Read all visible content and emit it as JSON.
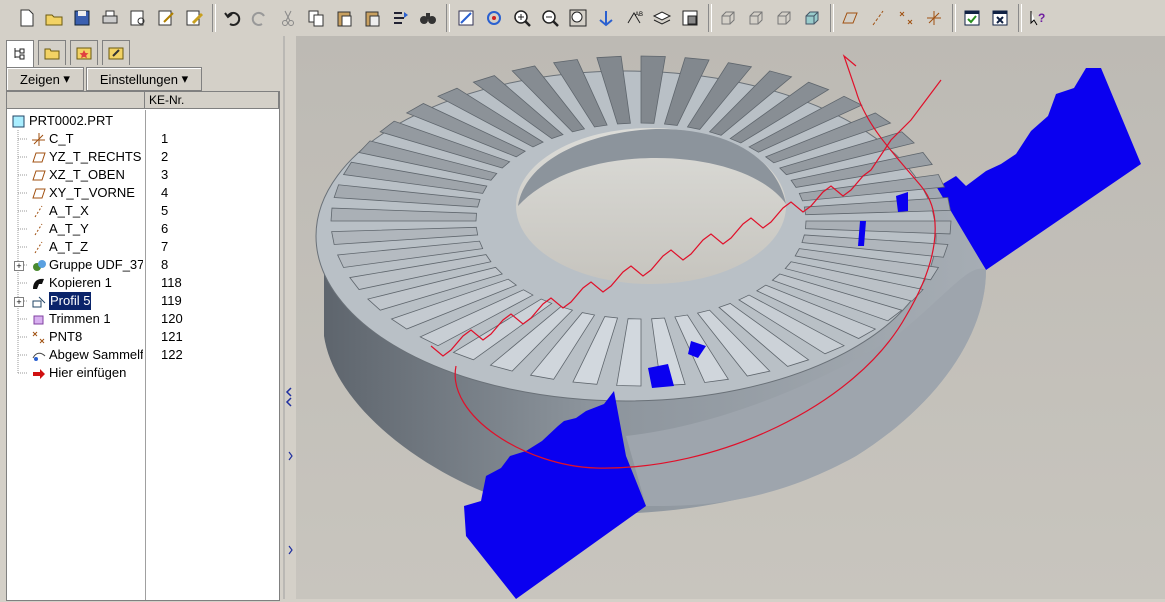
{
  "toolbar": {
    "groups": [
      [
        "new-icon",
        "open-icon",
        "save-icon",
        "print-icon",
        "preview-icon",
        "edit-icon",
        "erase-icon"
      ],
      [
        "undo-icon",
        "redo-icon",
        "cut-icon",
        "copy-icon",
        "paste-icon",
        "paste-special-icon",
        "regenerate-icon",
        "find-icon"
      ],
      [
        "repaint-icon",
        "spin-center-icon",
        "zoom-in-icon",
        "zoom-out-icon",
        "refit-icon",
        "orient-icon",
        "named-views-icon",
        "layers-icon",
        "view-manager-icon"
      ],
      [
        "wireframe-icon",
        "hidden-line-icon",
        "no-hidden-icon",
        "shading-icon"
      ],
      [
        "datum-planes-icon",
        "datum-axes-icon",
        "datum-points-icon",
        "coord-sys-icon"
      ],
      [
        "window-activate-icon",
        "window-close-icon"
      ],
      [
        "context-help-icon"
      ]
    ]
  },
  "panel": {
    "tabs": [
      "model-tree-tab-icon",
      "folder-tab-icon",
      "favorites-tab-icon",
      "connections-tab-icon"
    ],
    "show_label": "Zeigen",
    "settings_label": "Einstellungen",
    "col_header": "KE-Nr."
  },
  "tree": {
    "root": "PRT0002.PRT",
    "items": [
      {
        "label": "C_T",
        "num": "1",
        "icon": "csys-icon",
        "expander": false
      },
      {
        "label": "YZ_T_RECHTS",
        "num": "2",
        "icon": "datum-plane-icon",
        "expander": false
      },
      {
        "label": "XZ_T_OBEN",
        "num": "3",
        "icon": "datum-plane-icon",
        "expander": false
      },
      {
        "label": "XY_T_VORNE",
        "num": "4",
        "icon": "datum-plane-icon",
        "expander": false
      },
      {
        "label": "A_T_X",
        "num": "5",
        "icon": "datum-axis-icon",
        "expander": false
      },
      {
        "label": "A_T_Y",
        "num": "6",
        "icon": "datum-axis-icon",
        "expander": false
      },
      {
        "label": "A_T_Z",
        "num": "7",
        "icon": "datum-axis-icon",
        "expander": false
      },
      {
        "label": "Gruppe UDF_37",
        "num": "8",
        "icon": "group-icon",
        "expander": true
      },
      {
        "label": "Kopieren 1",
        "num": "118",
        "icon": "copy-feature-icon",
        "expander": false
      },
      {
        "label": "Profil 5",
        "num": "119",
        "icon": "profile-icon",
        "expander": true,
        "selected": true
      },
      {
        "label": "Trimmen 1",
        "num": "120",
        "icon": "trim-icon",
        "expander": false
      },
      {
        "label": "PNT8",
        "num": "121",
        "icon": "datum-point-icon",
        "expander": false
      },
      {
        "label": "Abgew Sammelfl",
        "num": "122",
        "icon": "surface-icon",
        "expander": false
      },
      {
        "label": "Hier einfügen",
        "num": "",
        "icon": "insert-here-icon",
        "expander": false
      }
    ]
  },
  "viewport": {
    "gear_color": "#a9b0b8",
    "gear_dark": "#7a828b",
    "cutter_color": "#0000ee",
    "curve_color": "#e0102a"
  }
}
